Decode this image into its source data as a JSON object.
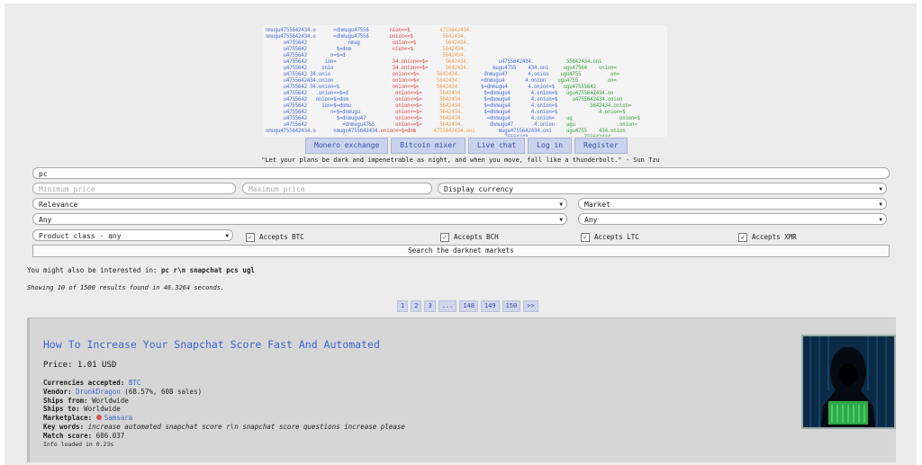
{
  "logo_lines": [
    {
      "segments": [
        {
          "t": "nmugu4755642434.o      =dnmugu47556       nion<=$         4755642434.",
          "c": "mixed"
        }
      ]
    }
  ],
  "nav": [
    "Monero exchange",
    "Bitcoin mixer",
    "Live chat",
    "Log in",
    "Register"
  ],
  "quote": "\"Let your plans be dark and impenetrable as night, and when you move, fall like a thunderbolt.\" - Sun Tzu",
  "search": {
    "query": "pc",
    "min_price_placeholder": "Minimum price",
    "max_price_placeholder": "Maximum price",
    "currency": "Display currency",
    "sort": "Relevance",
    "market": "Market",
    "any1": "Any",
    "any2": "Any",
    "product_class": "Product class - any",
    "accepts": [
      "Accepts BTC",
      "Accepts BCH",
      "Accepts LTC",
      "Accepts XMR"
    ],
    "button": "Search the darknet markets"
  },
  "interest_prefix": "You might also be interested in: ",
  "interest_terms": "pc r\\n snapchat pcs ugl",
  "showing": "Showing 10 of 1500 results found in 46.3264 seconds.",
  "pages": [
    "1",
    "2",
    "3",
    "...",
    "148",
    "149",
    "150",
    ">>"
  ],
  "result": {
    "title": "How To Increase Your Snapchat Score Fast And Automated",
    "price": "Price: 1.01 USD",
    "currencies_label": "Currencies accepted: ",
    "currencies": "BTC",
    "vendor_label": "Vendor: ",
    "vendor": "DrunkDragon",
    "vendor_stats": " (68.57%, 608 sales)",
    "ships_from_label": "Ships from: ",
    "ships_from": "Worldwide",
    "ships_to_label": "Ships to: ",
    "ships_to": "Worldwide",
    "marketplace_label": "Marketplace: ",
    "marketplace": "Samsara",
    "keywords_label": "Key words: ",
    "keywords": "increase automated snapchat score r\\n snapchat score questions increase please",
    "match_label": "Match score: ",
    "match": "606.037",
    "info": "Info loaded in 0.23s"
  },
  "colors": {
    "accent": "#3b66d0",
    "nav_bg": "#c9d3ee",
    "result_bg": "#d6d6d6"
  }
}
